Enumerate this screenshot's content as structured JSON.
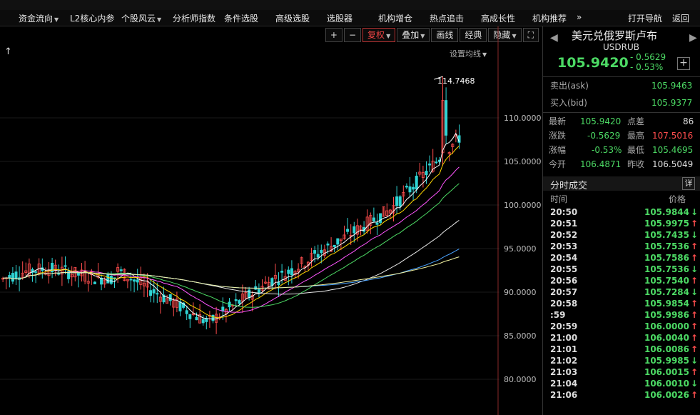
{
  "menu": {
    "items": [
      "资金流向",
      "L2核心内参",
      "个股风云",
      "分析师指数",
      "条件选股",
      "高级选股",
      "选股器",
      "机构增仓",
      "热点追击",
      "高成长性",
      "机构推荐",
      "»",
      "打开导航",
      "返回"
    ]
  },
  "toolbar": {
    "plus": "+",
    "minus": "−",
    "fuquan": "复权",
    "diejia": "叠加",
    "huaxian": "画线",
    "jingdian": "经典",
    "yincang": "隐藏",
    "fullscreen": "⛶"
  },
  "chart": {
    "set_ma_label": "设置均线",
    "peak_label": "114.7468",
    "up_arrow": "↑",
    "y_ticks": [
      "110.0000",
      "105.0000",
      "100.0000",
      "95.0000",
      "90.0000",
      "85.0000",
      "80.0000"
    ]
  },
  "chart_data": {
    "type": "candlestick",
    "ylim": [
      79,
      117
    ],
    "y_ticks": [
      110,
      105,
      100,
      95,
      90,
      85,
      80
    ],
    "annotations": [
      {
        "text": "114.7468",
        "value": 114.7468
      }
    ],
    "colors": {
      "up": "#ff4d4d",
      "down": "#2fd4d4",
      "ma": [
        "#ffffff",
        "#ffd700",
        "#ff55ff",
        "#4cd964",
        "#e8e8e8",
        "#4aa3ff",
        "#f2f2a0"
      ]
    }
  },
  "quote": {
    "name": "美元兑俄罗斯卢布",
    "code": "USDRUB",
    "price": "105.9420",
    "change": "- 0.5629",
    "change_pct": "- 0.53%",
    "ask_label": "卖出(ask)",
    "ask": "105.9463",
    "bid_label": "买入(bid)",
    "bid": "105.9377",
    "latest_label": "最新",
    "latest": "105.9420",
    "spread_label": "点差",
    "spread": "86",
    "chg_label": "涨跌",
    "chg": "-0.5629",
    "high_label": "最高",
    "high": "107.5016",
    "pct_label": "涨幅",
    "pct": "-0.53%",
    "low_label": "最低",
    "low": "105.4695",
    "open_label": "今开",
    "open": "106.4871",
    "prev_label": "昨收",
    "prev": "106.5049"
  },
  "trades": {
    "title": "分时成交",
    "detail": "详",
    "col_time": "时间",
    "col_price": "价格",
    "rows": [
      {
        "time": "20:50",
        "price": "105.9844",
        "dir": "↓"
      },
      {
        "time": "20:51",
        "price": "105.9975",
        "dir": "↑"
      },
      {
        "time": "20:52",
        "price": "105.7435",
        "dir": "↓"
      },
      {
        "time": "20:53",
        "price": "105.7536",
        "dir": "↑"
      },
      {
        "time": "20:54",
        "price": "105.7586",
        "dir": "↑"
      },
      {
        "time": "20:55",
        "price": "105.7536",
        "dir": "↓"
      },
      {
        "time": "20:56",
        "price": "105.7540",
        "dir": "↑"
      },
      {
        "time": "20:57",
        "price": "105.7284",
        "dir": "↓"
      },
      {
        "time": "20:58",
        "price": "105.9854",
        "dir": "↑"
      },
      {
        "time": ":59",
        "price": "105.9986",
        "dir": "↑"
      },
      {
        "time": "20:59",
        "price": "106.0000",
        "dir": "↑"
      },
      {
        "time": "21:00",
        "price": "106.0040",
        "dir": "↑"
      },
      {
        "time": "21:01",
        "price": "106.0086",
        "dir": "↑"
      },
      {
        "time": "21:02",
        "price": "105.9985",
        "dir": "↓"
      },
      {
        "time": "21:03",
        "price": "106.0015",
        "dir": "↑"
      },
      {
        "time": "21:04",
        "price": "106.0010",
        "dir": "↓"
      },
      {
        "time": "21:06",
        "price": "106.0026",
        "dir": "↑"
      }
    ]
  }
}
